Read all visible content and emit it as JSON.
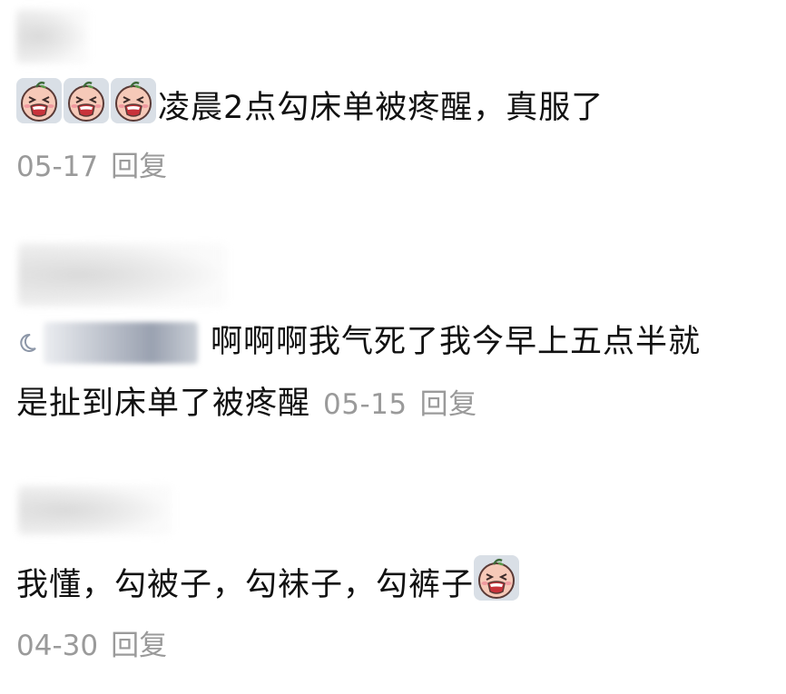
{
  "comments": [
    {
      "text": "凌晨2点勾床单被疼醒，真服了",
      "date": "05-17",
      "reply_label": "回复"
    },
    {
      "text_line1": "啊啊啊我气死了我今早上五点半就",
      "text_line2": "是扯到床单了被疼醒",
      "date": "05-15",
      "reply_label": "回复"
    },
    {
      "text": "我懂，勾被子，勾袜子，勾裤子",
      "date": "04-30",
      "reply_label": "回复"
    }
  ],
  "icons": {
    "emoji": "crying-peach-emoji",
    "badge": "moon-badge-icon"
  },
  "colors": {
    "text": "#111111",
    "meta": "#9a9a9a",
    "emoji_face": "#f6c9b8",
    "emoji_mouth": "#c8323a"
  }
}
